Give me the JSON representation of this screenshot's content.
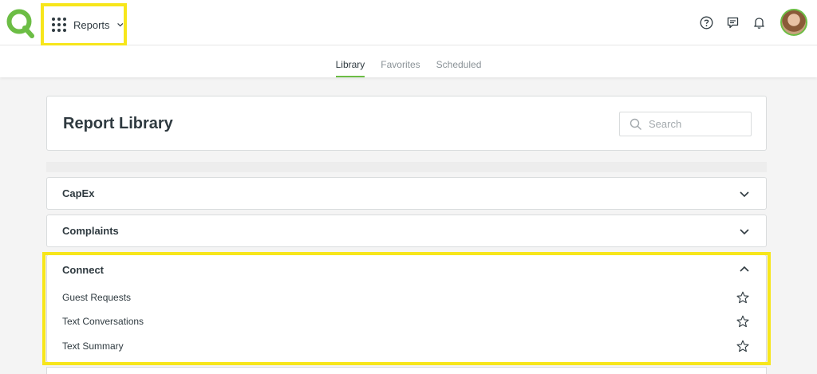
{
  "app": {
    "current_app": "Reports",
    "colors": {
      "brand_green": "#6cbd45",
      "highlight_yellow": "#f7e61b"
    }
  },
  "header_icons": [
    "help-icon",
    "chat-icon",
    "bell-icon",
    "avatar"
  ],
  "tabs": [
    {
      "label": "Library",
      "active": true
    },
    {
      "label": "Favorites",
      "active": false
    },
    {
      "label": "Scheduled",
      "active": false
    }
  ],
  "library": {
    "title": "Report Library",
    "search_placeholder": "Search",
    "search_value": ""
  },
  "sections": [
    {
      "title": "CapEx",
      "expanded": false,
      "items": []
    },
    {
      "title": "Complaints",
      "expanded": false,
      "items": []
    },
    {
      "title": "Connect",
      "expanded": true,
      "items": [
        {
          "label": "Guest Requests",
          "favorite": false
        },
        {
          "label": "Text Conversations",
          "favorite": false
        },
        {
          "label": "Text Summary",
          "favorite": false
        }
      ]
    }
  ]
}
